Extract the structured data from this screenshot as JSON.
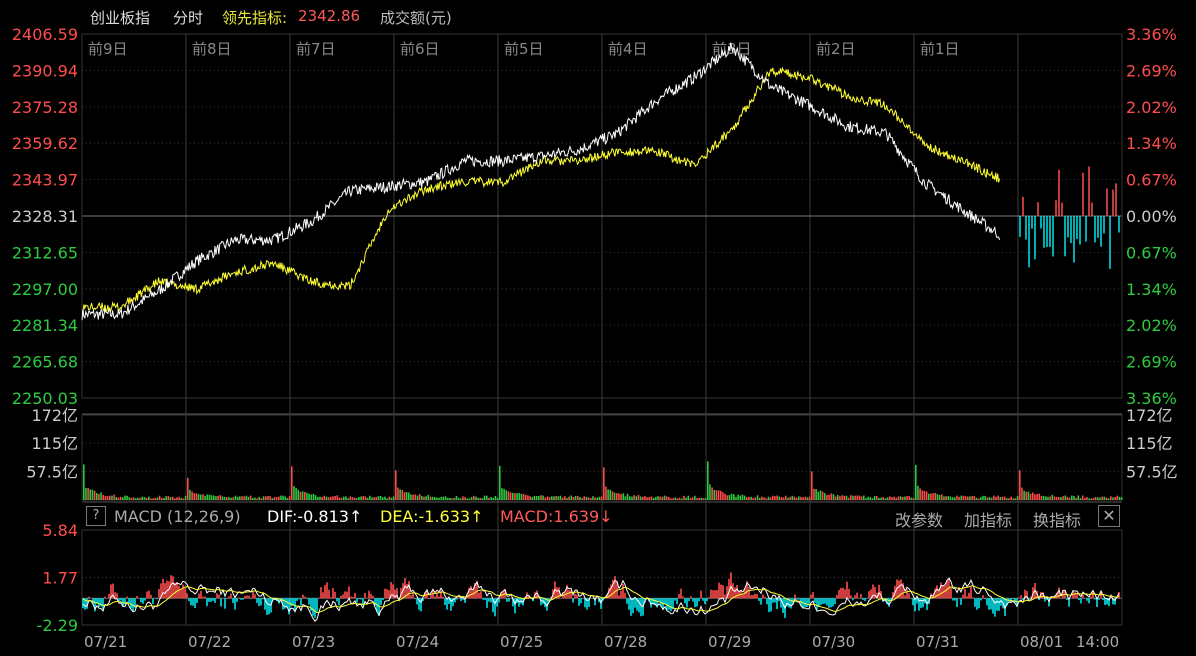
{
  "header": {
    "title": "创业板指",
    "mode": "分时",
    "leading_label": "领先指标:",
    "leading_value": "2342.86",
    "volume_label": "成交额(元)"
  },
  "macd_panel": {
    "help": "?",
    "indicator": "MACD (12,26,9)",
    "dif": "DIF:-0.813↑",
    "dea": "DEA:-1.633↑",
    "macd": "MACD:1.639↓",
    "btn_params": "改参数",
    "btn_add": "加指标",
    "btn_switch": "换指标",
    "btn_close": "✕"
  },
  "colors": {
    "up": "#ff4d4d",
    "down": "#2ecc40",
    "price_line": "#ffffff",
    "leading_line": "#ffff33",
    "macd_neg": "#00e5ee",
    "grid": "#3a3a3a",
    "day_label": "#888888"
  },
  "chart_data": [
    {
      "type": "line",
      "name": "price",
      "yticks_left": [
        "2406.59",
        "2390.94",
        "2375.28",
        "2359.62",
        "2343.97",
        "2328.31",
        "2312.65",
        "2297.00",
        "2281.34",
        "2265.68",
        "2250.03"
      ],
      "yticks_right": [
        "3.36%",
        "2.69%",
        "2.02%",
        "1.34%",
        "0.67%",
        "0.00%",
        "0.67%",
        "1.34%",
        "2.02%",
        "2.69%",
        "3.36%"
      ],
      "ylim": [
        2250.03,
        2406.59
      ],
      "reference": 2328.31,
      "day_labels": [
        "前9日",
        "前8日",
        "前7日",
        "前6日",
        "前5日",
        "前4日",
        "前3日",
        "前2日",
        "前1日"
      ],
      "price_close": [
        2286,
        2296,
        2309,
        2318,
        2318,
        2326,
        2339,
        2341,
        2343,
        2352,
        2352,
        2354,
        2357,
        2364,
        2378,
        2388,
        2401,
        2384,
        2376,
        2367,
        2364,
        2343,
        2331,
        2320
      ],
      "leading_close": [
        2289,
        2300,
        2297,
        2304,
        2308,
        2300,
        2298,
        2331,
        2340,
        2343,
        2343,
        2352,
        2352,
        2356,
        2356,
        2350,
        2366,
        2391,
        2388,
        2380,
        2376,
        2359,
        2352,
        2344
      ]
    },
    {
      "type": "bar",
      "name": "turnover",
      "yticks": [
        "172亿",
        "115亿",
        "57.5亿"
      ],
      "ylim": [
        0,
        172
      ],
      "daily_peak": [
        72,
        45,
        68,
        60,
        69,
        66,
        78,
        58,
        71,
        60
      ]
    },
    {
      "type": "bar",
      "name": "MACD",
      "yticks": [
        "5.84",
        "1.77",
        "-2.29"
      ],
      "ylim": [
        -2.29,
        5.84
      ],
      "xticks": [
        "07/21",
        "07/22",
        "07/23",
        "07/24",
        "07/25",
        "07/28",
        "07/29",
        "07/30",
        "07/31",
        "08/01",
        "14:00"
      ],
      "dif": -0.813,
      "dea": -1.633,
      "macd": 1.639
    }
  ]
}
